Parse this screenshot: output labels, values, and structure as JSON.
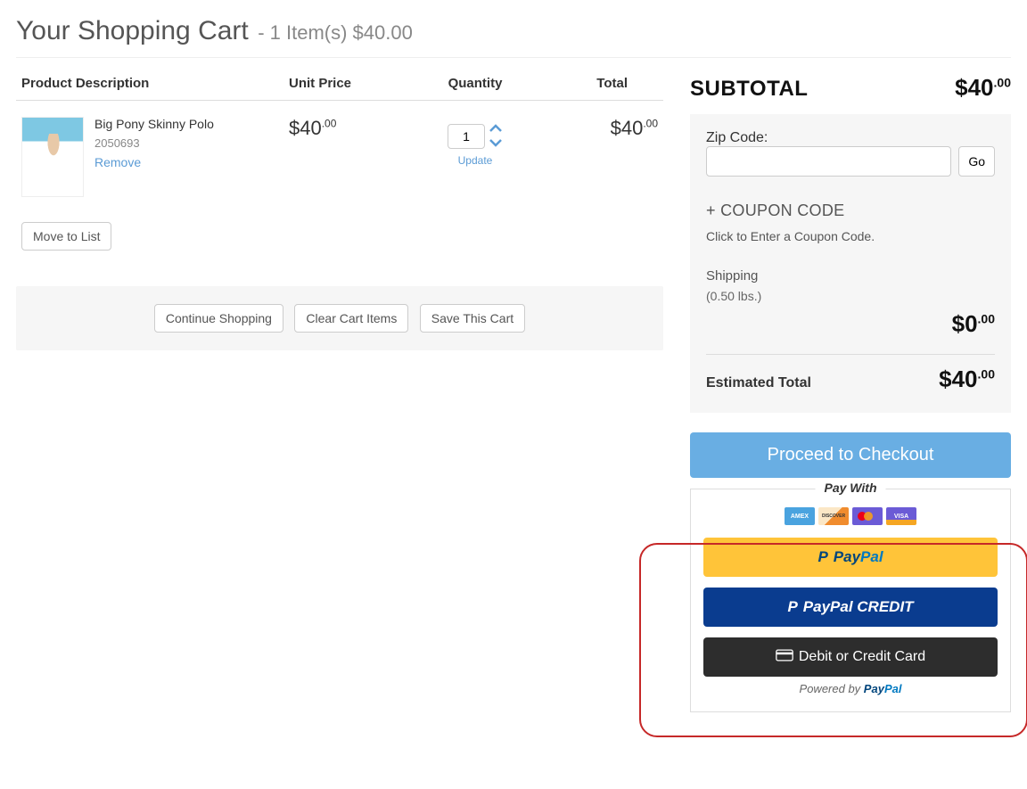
{
  "title": "Your Shopping Cart",
  "title_sub": "- 1 Item(s) $40.00",
  "headers": {
    "desc": "Product Description",
    "unit": "Unit Price",
    "qty": "Quantity",
    "total": "Total"
  },
  "item": {
    "name": "Big Pony Skinny Polo",
    "sku": "2050693",
    "remove": "Remove",
    "unit_dollars": "$40",
    "unit_cents": ".00",
    "qty": "1",
    "update": "Update",
    "total_dollars": "$40",
    "total_cents": ".00",
    "move": "Move to List"
  },
  "actions": {
    "continue": "Continue Shopping",
    "clear": "Clear Cart Items",
    "save": "Save This Cart"
  },
  "summary": {
    "subtotal_label": "SUBTOTAL",
    "subtotal_dollars": "$40",
    "subtotal_cents": ".00",
    "zip_label": "Zip Code:",
    "go": "Go",
    "coupon_header": "+ COUPON CODE",
    "coupon_sub": "Click to Enter a Coupon Code.",
    "shipping_label": "Shipping",
    "shipping_weight": "(0.50 lbs.)",
    "shipping_dollars": "$0",
    "shipping_cents": ".00",
    "est_label": "Estimated Total",
    "est_dollars": "$40",
    "est_cents": ".00"
  },
  "checkout": {
    "proceed": "Proceed to Checkout",
    "paywith": "Pay With",
    "cards": {
      "amex": "AMEX",
      "disc": "DISCOVER",
      "visa": "VISA"
    },
    "paypal_pay": "Pay",
    "paypal_pal": "Pal",
    "ppcredit": "PayPal CREDIT",
    "debit": "Debit or Credit Card",
    "powered_prefix": "Powered by ",
    "powered_pay": "Pay",
    "powered_pal": "Pal"
  }
}
